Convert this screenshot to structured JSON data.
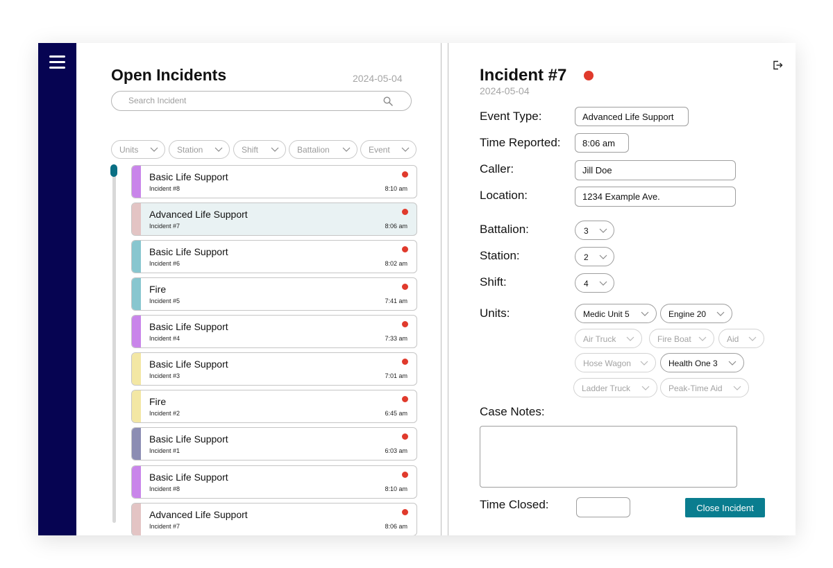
{
  "left": {
    "title": "Open Incidents",
    "date": "2024-05-04",
    "search_placeholder": "Search Incident",
    "filters": [
      "Units",
      "Station",
      "Shift",
      "Battalion",
      "Event"
    ]
  },
  "incidents": [
    {
      "title": "Basic Life Support",
      "sub": "Incident #8",
      "time": "8:10 am",
      "color": "#c985ea",
      "selected": false
    },
    {
      "title": "Advanced Life Support",
      "sub": "Incident #7",
      "time": "8:06 am",
      "color": "#e3c4c4",
      "selected": true
    },
    {
      "title": "Basic Life Support",
      "sub": "Incident #6",
      "time": "8:02 am",
      "color": "#88c6cf",
      "selected": false
    },
    {
      "title": "Fire",
      "sub": "Incident #5",
      "time": "7:41 am",
      "color": "#88c6cf",
      "selected": false
    },
    {
      "title": "Basic Life Support",
      "sub": "Incident #4",
      "time": "7:33 am",
      "color": "#c985ea",
      "selected": false
    },
    {
      "title": "Basic Life Support",
      "sub": "Incident #3",
      "time": "7:01 am",
      "color": "#f3e7a4",
      "selected": false
    },
    {
      "title": "Fire",
      "sub": "Incident #2",
      "time": "6:45 am",
      "color": "#f3e7a4",
      "selected": false
    },
    {
      "title": "Basic Life Support",
      "sub": "Incident #1",
      "time": "6:03 am",
      "color": "#8c8db3",
      "selected": false
    },
    {
      "title": "Basic Life Support",
      "sub": "Incident #8",
      "time": "8:10 am",
      "color": "#c985ea",
      "selected": false
    },
    {
      "title": "Advanced Life Support",
      "sub": "Incident #7",
      "time": "8:06 am",
      "color": "#e3c4c4",
      "selected": false
    }
  ],
  "detail": {
    "title": "Incident #7",
    "date": "2024-05-04",
    "status_color": "#e03a2c",
    "labels": {
      "event_type": "Event Type:",
      "time_reported": "Time Reported:",
      "caller": "Caller:",
      "location": "Location:",
      "battalion": "Battalion:",
      "station": "Station:",
      "shift": "Shift:",
      "units": "Units:",
      "case_notes": "Case Notes:",
      "time_closed": "Time Closed:"
    },
    "event_type": "Advanced Life Support",
    "time_reported": "8:06 am",
    "caller": "Jill Doe",
    "location": "1234 Example Ave.",
    "battalion": "3",
    "station": "2",
    "shift": "4",
    "units": [
      {
        "label": "Medic Unit 5",
        "active": true
      },
      {
        "label": "Engine 20",
        "active": true
      },
      {
        "label": "Air Truck",
        "active": false
      },
      {
        "label": "Fire Boat",
        "active": false
      },
      {
        "label": "Aid",
        "active": false
      },
      {
        "label": "Hose Wagon",
        "active": false
      },
      {
        "label": "Health One 3",
        "active": true
      },
      {
        "label": "Ladder Truck",
        "active": false
      },
      {
        "label": "Peak-Time Aid",
        "active": false
      }
    ],
    "case_notes": "",
    "time_closed": "",
    "close_button": "Close Incident"
  },
  "icons": {
    "menu": "hamburger-menu-icon",
    "search": "search-icon",
    "logout": "logout-icon",
    "dropdown": "chevron-down-icon"
  },
  "colors": {
    "sidebar": "#060452",
    "accent": "#0a7d8f",
    "status_red": "#e03a2c"
  }
}
